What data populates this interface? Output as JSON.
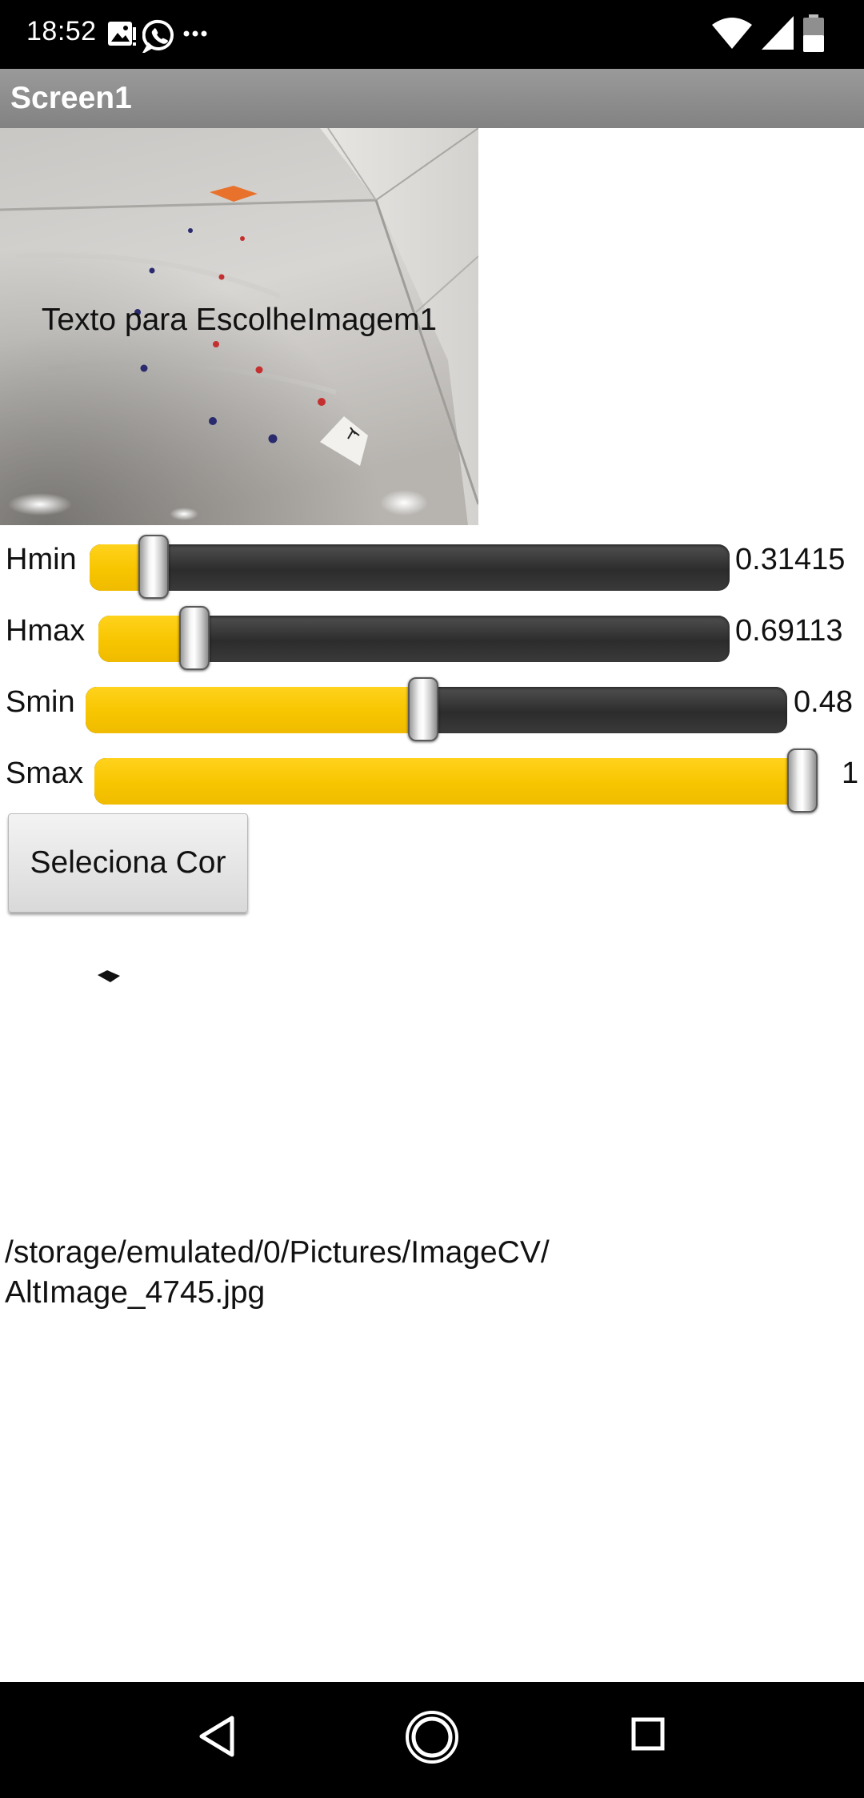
{
  "status_bar": {
    "time": "18:52",
    "icons": [
      "image-icon",
      "whatsapp-icon",
      "more-icon",
      "wifi-icon",
      "signal-icon",
      "battery-icon"
    ]
  },
  "title_bar": {
    "title": "Screen1"
  },
  "image_picker": {
    "label": "Texto para EscolheImagem1"
  },
  "sliders": [
    {
      "label": "Hmin",
      "value_text": "0.31415",
      "fraction": 0.08
    },
    {
      "label": "Hmax",
      "value_text": "0.69113",
      "fraction": 0.135
    },
    {
      "label": "Smin",
      "value_text": "0.48",
      "fraction": 0.48
    },
    {
      "label": "Smax",
      "value_text": "1",
      "fraction": 1.0
    }
  ],
  "button": {
    "label": "Seleciona Cor"
  },
  "file_path": {
    "line1": "/storage/emulated/0/Pictures/ImageCV/",
    "line2": "AltImage_4745.jpg"
  },
  "nav_bar": {
    "icons": [
      "back-icon",
      "home-icon",
      "recents-icon"
    ]
  },
  "colors": {
    "slider_fill": "#f7c500",
    "slider_track": "#3a3a3a",
    "title_bar": "#8e8e8e"
  }
}
